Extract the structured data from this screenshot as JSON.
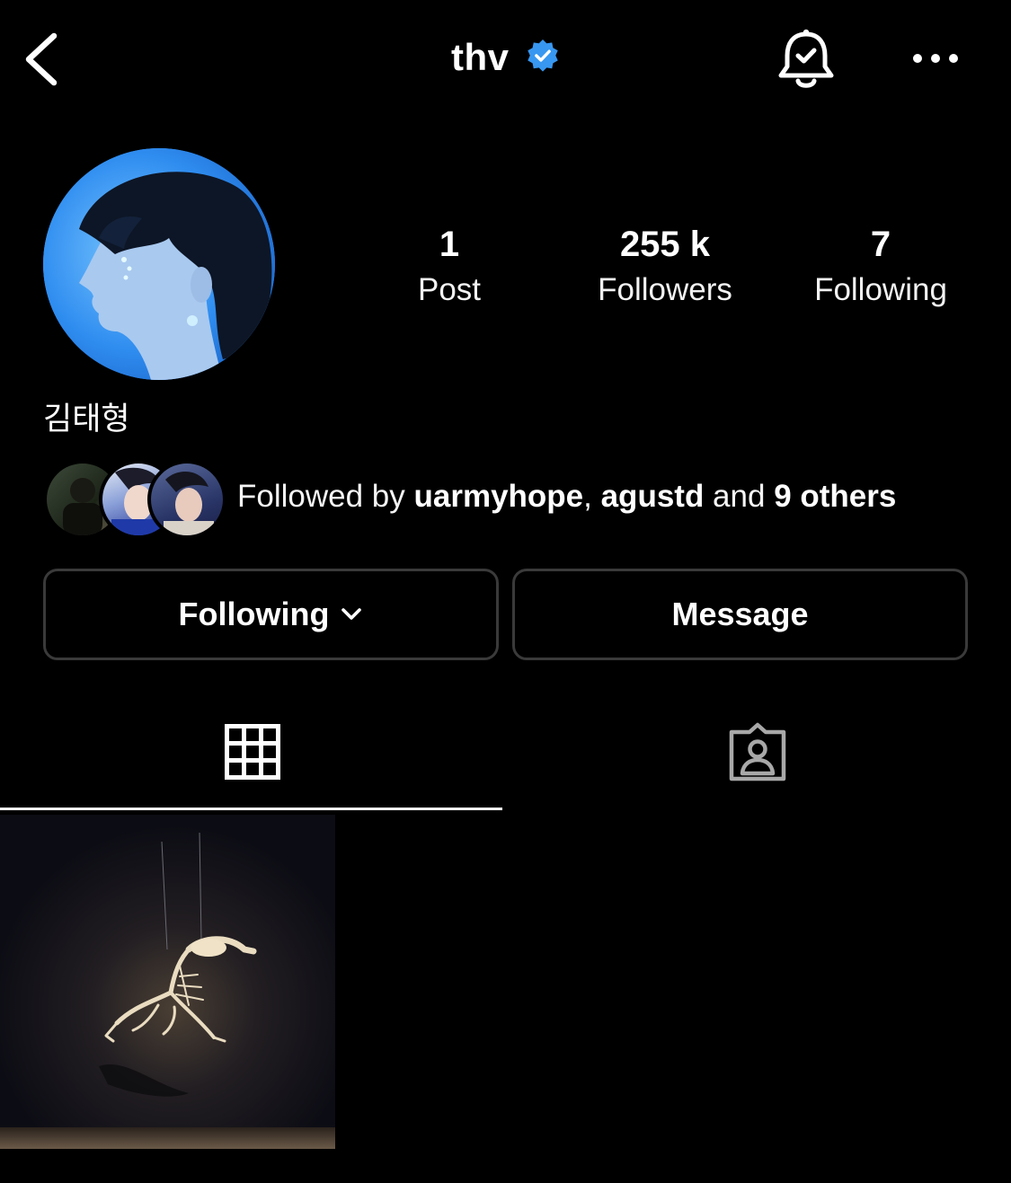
{
  "header": {
    "title": "thv",
    "verified": true,
    "back_icon": "chevron-left-icon",
    "bell_icon": "bell-check-icon",
    "more_icon": "more-horizontal-icon"
  },
  "profile": {
    "full_name": "김태형",
    "stats": [
      {
        "value": "1",
        "label": "Post"
      },
      {
        "value": "255 k",
        "label": "Followers"
      },
      {
        "value": "7",
        "label": "Following"
      }
    ],
    "followed_by": {
      "prefix": "Followed by ",
      "user1": "uarmyhope",
      "separator": ", ",
      "user2": "agustd",
      "and": " and ",
      "others": "9 others"
    }
  },
  "actions": {
    "following_label": "Following",
    "message_label": "Message"
  },
  "tabs": [
    {
      "icon": "grid-icon",
      "active": true
    },
    {
      "icon": "tagged-person-icon",
      "active": false
    }
  ],
  "colors": {
    "background": "#000000",
    "text": "#ffffff",
    "verified_blue": "#3897f0",
    "button_border": "#3a3a3a"
  }
}
